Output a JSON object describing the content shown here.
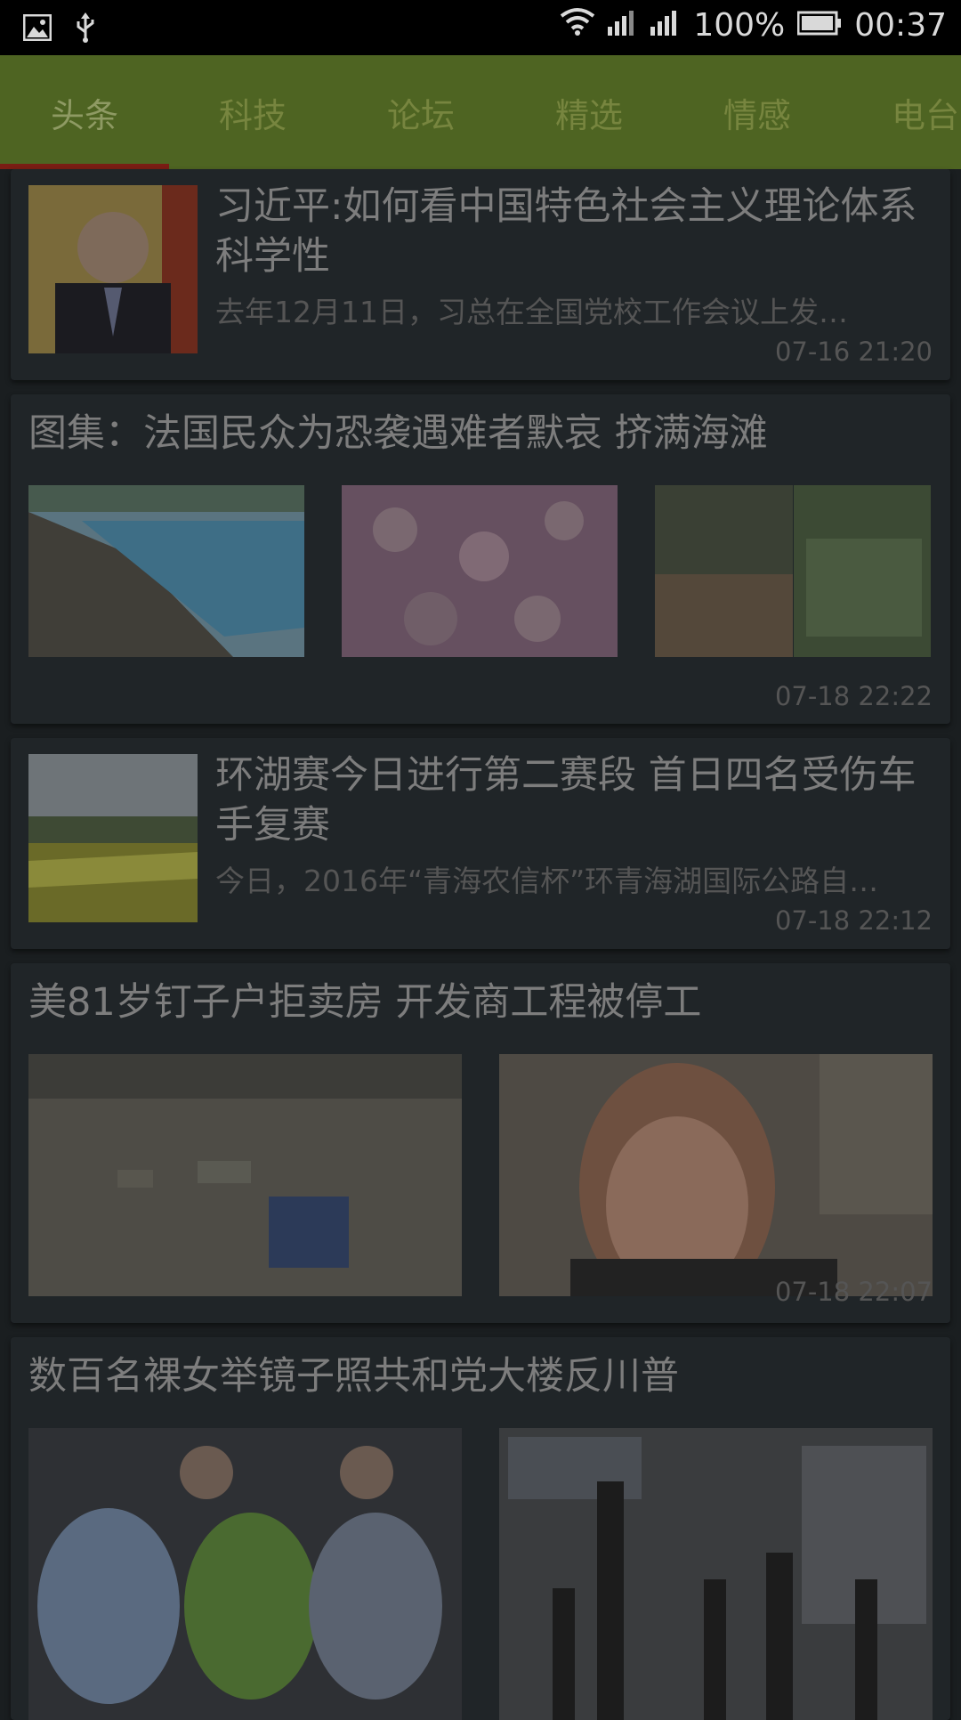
{
  "status_bar": {
    "battery": "100%",
    "time": "00:37",
    "icons": [
      "image-icon",
      "usb-icon",
      "wifi-icon",
      "signal-icon",
      "signal-icon",
      "battery-icon"
    ]
  },
  "tabs": [
    {
      "label": "头条",
      "active": true
    },
    {
      "label": "科技",
      "active": false
    },
    {
      "label": "论坛",
      "active": false
    },
    {
      "label": "精选",
      "active": false
    },
    {
      "label": "情感",
      "active": false
    },
    {
      "label": "电台",
      "active": false
    }
  ],
  "accent_colors": {
    "tabbar": "#4e6422",
    "indicator": "#7a1d14",
    "card": "#202528",
    "background": "#1a1e20"
  },
  "feed": [
    {
      "title": "习近平:如何看中国特色社会主义理论体系科学性",
      "summary": "去年12月11日，习总在全国党校工作会议上发…",
      "time": "07-16 21:20"
    },
    {
      "title": "图集：法国民众为恐袭遇难者默哀 挤满海滩",
      "time": "07-18 22:22"
    },
    {
      "title": "环湖赛今日进行第二赛段 首日四名受伤车手复赛",
      "summary": "今日，2016年“青海农信杯”环青海湖国际公路自…",
      "time": "07-18 22:12"
    },
    {
      "title": "美81岁钉子户拒卖房 开发商工程被停工",
      "time": "07-18 22:07"
    },
    {
      "title": "数百名裸女举镜子照共和党大楼反川普"
    }
  ]
}
